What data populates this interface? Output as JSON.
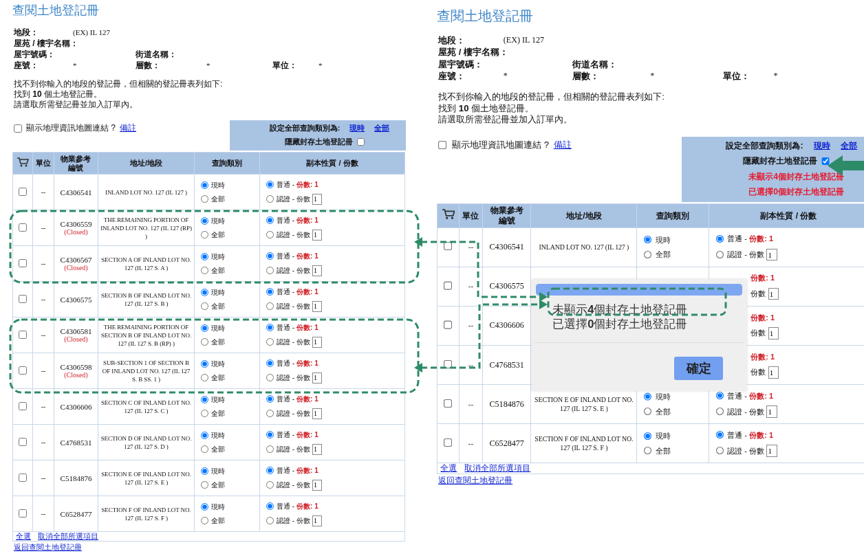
{
  "panels": [
    {
      "title": "查閱土地登記冊",
      "info": [
        [
          {
            "label": "地段：",
            "value": "(EX) IL 127"
          }
        ],
        [
          {
            "label": "屋苑 / 樓宇名稱："
          }
        ],
        [
          {
            "label": "屋宇號碼："
          },
          {
            "label": "街道名稱："
          }
        ],
        [
          {
            "label": "座號：",
            "value": "*"
          },
          {
            "label": "層數：",
            "value": "*"
          },
          {
            "label": "單位：",
            "value": "*"
          }
        ]
      ],
      "messages": [
        "找不到你輸入的地段的登記冊，但相關的登記冊表列如下:",
        "找到 **10** 個土地登記冊。",
        "請選取所需登記冊並加入訂單內。"
      ],
      "map_toggle": {
        "label": "顯示地理資訊地圖連結 ?",
        "link": "備註",
        "checked": false
      },
      "settings": {
        "label": "設定全部查詢類別為:",
        "links": [
          "現時",
          "全部"
        ],
        "hide_closed": {
          "label": "隱藏封存土地登記冊",
          "checked": false
        }
      },
      "columns": [
        {
          "kind": "cart"
        },
        {
          "kind": "text",
          "label": "單位"
        },
        {
          "kind": "text",
          "label": "物業參考編號"
        },
        {
          "kind": "text",
          "label": "地址/地段"
        },
        {
          "kind": "text",
          "label": "查詢類別"
        },
        {
          "kind": "text",
          "label": "副本性質 / 份數"
        }
      ],
      "rows": [
        {
          "checked": false,
          "unit": "--",
          "ref": "C4306541",
          "address": "INLAND LOT NO. 127 (IL 127 )",
          "query": [
            {
              "label": "現時",
              "selected": true
            },
            {
              "label": "全部",
              "selected": false
            }
          ],
          "copy": {
            "ordinary": {
              "label": "普通 -",
              "count": "份數: 1",
              "selected": true
            },
            "certified": {
              "label": "認證 - 份數",
              "value": "1",
              "selected": false
            }
          }
        },
        {
          "checked": false,
          "unit": "--",
          "ref": "C4306559",
          "status": "(Closed)",
          "address": "THE REMAINING PORTION OF INLAND LOT NO. 127 (IL 127 (RP) )",
          "query": [
            {
              "label": "現時",
              "selected": true
            },
            {
              "label": "全部",
              "selected": false
            }
          ],
          "copy": {
            "ordinary": {
              "label": "普通 -",
              "count": "份數: 1",
              "selected": true
            },
            "certified": {
              "label": "認證 - 份數",
              "value": "1",
              "selected": false
            }
          }
        },
        {
          "checked": false,
          "unit": "--",
          "ref": "C4306567",
          "status": "(Closed)",
          "address": "SECTION A OF INLAND LOT NO. 127 (IL 127 S. A )",
          "query": [
            {
              "label": "現時",
              "selected": true
            },
            {
              "label": "全部",
              "selected": false
            }
          ],
          "copy": {
            "ordinary": {
              "label": "普通 -",
              "count": "份數: 1",
              "selected": true
            },
            "certified": {
              "label": "認證 - 份數",
              "value": "1",
              "selected": false
            }
          }
        },
        {
          "checked": false,
          "unit": "--",
          "ref": "C4306575",
          "address": "SECTION B OF INLAND LOT NO. 127 (IL 127 S. B )",
          "query": [
            {
              "label": "現時",
              "selected": true
            },
            {
              "label": "全部",
              "selected": false
            }
          ],
          "copy": {
            "ordinary": {
              "label": "普通 -",
              "count": "份數: 1",
              "selected": true
            },
            "certified": {
              "label": "認證 - 份數",
              "value": "1",
              "selected": false
            }
          }
        },
        {
          "checked": false,
          "unit": "--",
          "ref": "C4306581",
          "status": "(Closed)",
          "address": "THE REMAINING PORTION OF SECTION B OF INLAND LOT NO. 127 (IL 127 S. B (RP) )",
          "query": [
            {
              "label": "現時",
              "selected": true
            },
            {
              "label": "全部",
              "selected": false
            }
          ],
          "copy": {
            "ordinary": {
              "label": "普通 -",
              "count": "份數: 1",
              "selected": true
            },
            "certified": {
              "label": "認證 - 份數",
              "value": "1",
              "selected": false
            }
          }
        },
        {
          "checked": false,
          "unit": "--",
          "ref": "C4306598",
          "status": "(Closed)",
          "address": "SUB-SECTION 1 OF SECTION B OF INLAND LOT NO. 127 (IL 127 S. B SS. 1 )",
          "query": [
            {
              "label": "現時",
              "selected": true
            },
            {
              "label": "全部",
              "selected": false
            }
          ],
          "copy": {
            "ordinary": {
              "label": "普通 -",
              "count": "份數: 1",
              "selected": true
            },
            "certified": {
              "label": "認證 - 份數",
              "value": "1",
              "selected": false
            }
          }
        },
        {
          "checked": false,
          "unit": "--",
          "ref": "C4306606",
          "address": "SECTION C OF INLAND LOT NO. 127 (IL 127 S. C )",
          "query": [
            {
              "label": "現時",
              "selected": true
            },
            {
              "label": "全部",
              "selected": false
            }
          ],
          "copy": {
            "ordinary": {
              "label": "普通 -",
              "count": "份數: 1",
              "selected": true
            },
            "certified": {
              "label": "認證 - 份數",
              "value": "1",
              "selected": false
            }
          }
        },
        {
          "checked": false,
          "unit": "--",
          "ref": "C4768531",
          "address": "SECTION D OF INLAND LOT NO. 127 (IL 127 S. D )",
          "query": [
            {
              "label": "現時",
              "selected": true
            },
            {
              "label": "全部",
              "selected": false
            }
          ],
          "copy": {
            "ordinary": {
              "label": "普通 -",
              "count": "份數: 1",
              "selected": true
            },
            "certified": {
              "label": "認證 - 份數",
              "value": "1",
              "selected": false
            }
          }
        },
        {
          "checked": false,
          "unit": "--",
          "ref": "C5184876",
          "address": "SECTION E OF INLAND LOT NO. 127 (IL 127 S. E )",
          "query": [
            {
              "label": "現時",
              "selected": true
            },
            {
              "label": "全部",
              "selected": false
            }
          ],
          "copy": {
            "ordinary": {
              "label": "普通 -",
              "count": "份數: 1",
              "selected": true
            },
            "certified": {
              "label": "認證 - 份數",
              "value": "1",
              "selected": false
            }
          }
        },
        {
          "checked": false,
          "unit": "--",
          "ref": "C6528477",
          "address": "SECTION F OF INLAND LOT NO. 127 (IL 127 S. F )",
          "query": [
            {
              "label": "現時",
              "selected": true
            },
            {
              "label": "全部",
              "selected": false
            }
          ],
          "copy": {
            "ordinary": {
              "label": "普通 -",
              "count": "份數: 1",
              "selected": true
            },
            "certified": {
              "label": "認證 - 份數",
              "value": "1",
              "selected": false
            }
          }
        }
      ],
      "footer_links": [
        "全選",
        "取消全部所選項目"
      ],
      "back_link": "返回查閱土地登記冊"
    },
    {
      "title": "查閱土地登記冊",
      "info": [
        [
          {
            "label": "地段：",
            "value": "(EX) IL 127"
          }
        ],
        [
          {
            "label": "屋苑 / 樓宇名稱："
          }
        ],
        [
          {
            "label": "屋宇號碼："
          },
          {
            "label": "街道名稱："
          }
        ],
        [
          {
            "label": "座號：",
            "value": "*"
          },
          {
            "label": "層數：",
            "value": "*"
          },
          {
            "label": "單位：",
            "value": "*"
          }
        ]
      ],
      "messages": [
        "找不到你輸入的地段的登記冊，但相關的登記冊表列如下:",
        "找到 **10** 個土地登記冊。",
        "請選取所需登記冊並加入訂單內。"
      ],
      "map_toggle": {
        "label": "顯示地理資訊地圖連結 ?",
        "link": "備註",
        "checked": false
      },
      "settings": {
        "label": "設定全部查詢類別為:",
        "links": [
          "現時",
          "全部"
        ],
        "hide_closed": {
          "label": "隱藏封存土地登記冊",
          "checked": true
        },
        "notes": [
          "未顯示4個封存土地登記冊",
          "已選擇0個封存土地登記冊"
        ]
      },
      "columns": [
        {
          "kind": "cart"
        },
        {
          "kind": "text",
          "label": "單位"
        },
        {
          "kind": "text",
          "label": "物業參考編號"
        },
        {
          "kind": "text",
          "label": "地址/地段"
        },
        {
          "kind": "text",
          "label": "查詢類別"
        },
        {
          "kind": "text",
          "label": "副本性質 / 份數"
        }
      ],
      "rows": [
        {
          "checked": false,
          "unit": "--",
          "ref": "C4306541",
          "address": "INLAND LOT NO. 127 (IL 127 )",
          "query": [
            {
              "label": "現時",
              "selected": true
            },
            {
              "label": "全部",
              "selected": false
            }
          ],
          "copy": {
            "ordinary": {
              "label": "普通 -",
              "count": "份數: 1",
              "selected": true
            },
            "certified": {
              "label": "認證 - 份數",
              "value": "1",
              "selected": false
            }
          }
        },
        {
          "covered": true,
          "checked": false,
          "unit": "--",
          "ref": "C4306575",
          "copy": {
            "ordinary": {
              "count": "份數: 1"
            },
            "certified": {
              "label": "份數",
              "value": "1"
            }
          }
        },
        {
          "covered": true,
          "checked": false,
          "unit": "--",
          "ref": "C4306606",
          "copy": {
            "ordinary": {
              "count": "份數: 1"
            },
            "certified": {
              "label": "份數",
              "value": "1"
            }
          }
        },
        {
          "covered": true,
          "checked": false,
          "unit": "--",
          "ref": "C4768531",
          "copy": {
            "ordinary": {
              "count": "份數: 1"
            },
            "certified": {
              "label": "份數",
              "value": "1"
            }
          }
        },
        {
          "checked": false,
          "unit": "--",
          "ref": "C5184876",
          "address": "SECTION E OF INLAND LOT NO. 127 (IL 127 S. E )",
          "query": [
            {
              "label": "現時",
              "selected": true
            },
            {
              "label": "全部",
              "selected": false
            }
          ],
          "copy": {
            "ordinary": {
              "label": "普通 -",
              "count": "份數: 1",
              "selected": true
            },
            "certified": {
              "label": "認證 - 份數",
              "value": "1",
              "selected": false
            }
          }
        },
        {
          "checked": false,
          "unit": "--",
          "ref": "C6528477",
          "address": "SECTION F OF INLAND LOT NO. 127 (IL 127 S. F )",
          "query": [
            {
              "label": "現時",
              "selected": true
            },
            {
              "label": "全部",
              "selected": false
            }
          ],
          "copy": {
            "ordinary": {
              "label": "普通 -",
              "count": "份數: 1",
              "selected": true
            },
            "certified": {
              "label": "認證 - 份數",
              "value": "1",
              "selected": false
            }
          }
        }
      ],
      "footer_links": [
        "全選",
        "取消全部所選項目"
      ],
      "back_link": "返回查閱土地登記冊",
      "dialog": {
        "lines": [
          "未顯示**4**個封存土地登記冊",
          "已選擇**0**個封存土地登記冊"
        ],
        "button": "確定"
      }
    }
  ]
}
